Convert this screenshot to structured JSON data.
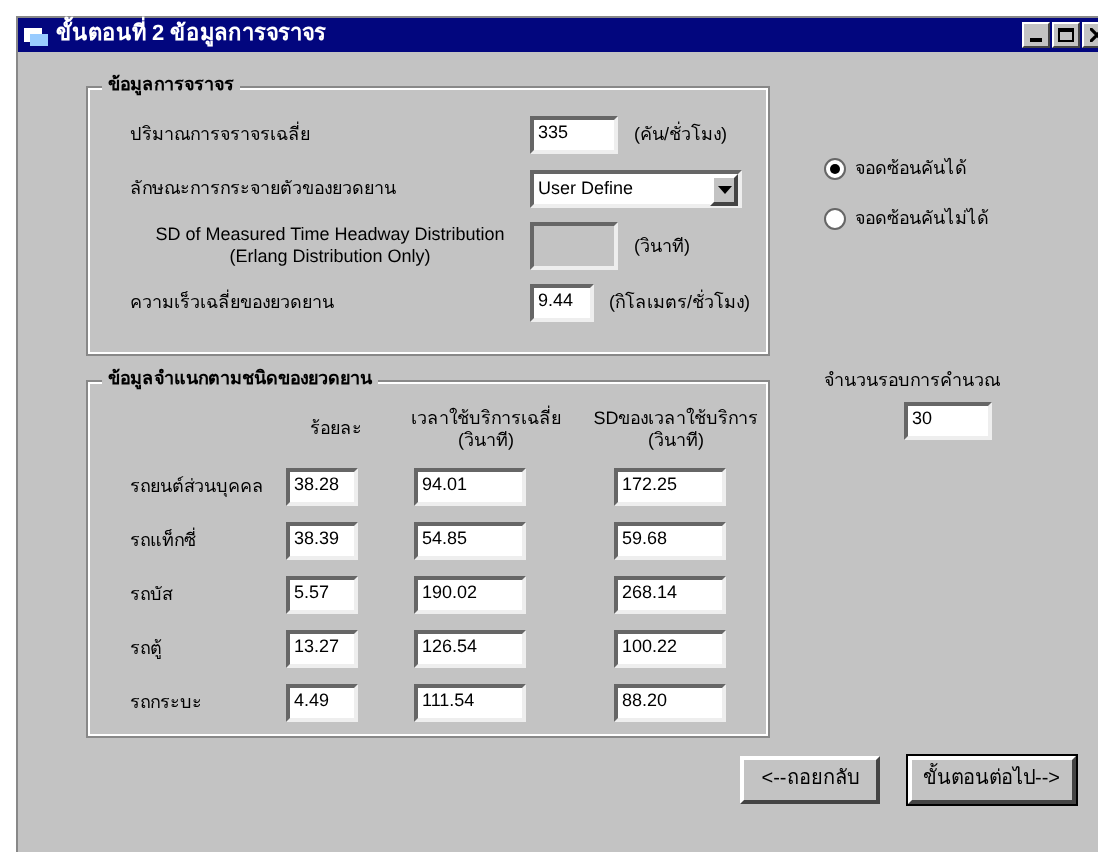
{
  "window": {
    "title": "ขั้นตอนที่ 2 ข้อมูลการจราจร"
  },
  "traffic": {
    "title": "ข้อมูลการจราจร",
    "fields": [
      {
        "kind": "text",
        "label": "ปริมาณการจราจรเฉลี่ย",
        "value": "335",
        "unit": "(คัน/ชั่วโมง)"
      },
      {
        "kind": "select",
        "label": "ลักษณะการกระจายตัวของยวดยาน",
        "value": "User Define"
      },
      {
        "kind": "text",
        "label": "SD of Measured Time Headway Distribution\n(Erlang Distribution Only)",
        "disabled": true,
        "unit": "(วินาที)"
      },
      {
        "kind": "text",
        "label": "ความเร็วเฉลี่ยของยวดยาน",
        "value": "9.44",
        "unit": "(กิโลเมตร/ชั่วโมง)"
      }
    ]
  },
  "vehicles": {
    "title": "ข้อมูลจำแนกตามชนิดของยวดยาน",
    "columns": [
      "ร้อยละ",
      "เวลาใช้บริการเฉลี่ย\n(วินาที)",
      "SDของเวลาใช้บริการ\n(วินาที)"
    ],
    "rows": [
      {
        "name": "รถยนต์ส่วนบุคคล",
        "values": [
          "38.28",
          "94.01",
          "172.25"
        ]
      },
      {
        "name": "รถแท็กซี่",
        "values": [
          "38.39",
          "54.85",
          "59.68"
        ]
      },
      {
        "name": "รถบัส",
        "values": [
          "5.57",
          "190.02",
          "268.14"
        ]
      },
      {
        "name": "รถตู้",
        "values": [
          "13.27",
          "126.54",
          "100.22"
        ]
      },
      {
        "name": "รถกระบะ",
        "values": [
          "4.49",
          "111.54",
          "88.20"
        ]
      }
    ]
  },
  "parking": [
    {
      "label": "จอดซ้อนคันได้",
      "selected": true
    },
    {
      "label": "จอดซ้อนคันไม่ได้",
      "selected": false
    }
  ],
  "iterations": {
    "label": "จำนวนรอบการคำนวณ",
    "value": "30"
  },
  "buttons": [
    {
      "label": "<--ถอยกลับ",
      "default": false
    },
    {
      "label": "ขั้นตอนต่อไป-->",
      "default": true
    }
  ]
}
